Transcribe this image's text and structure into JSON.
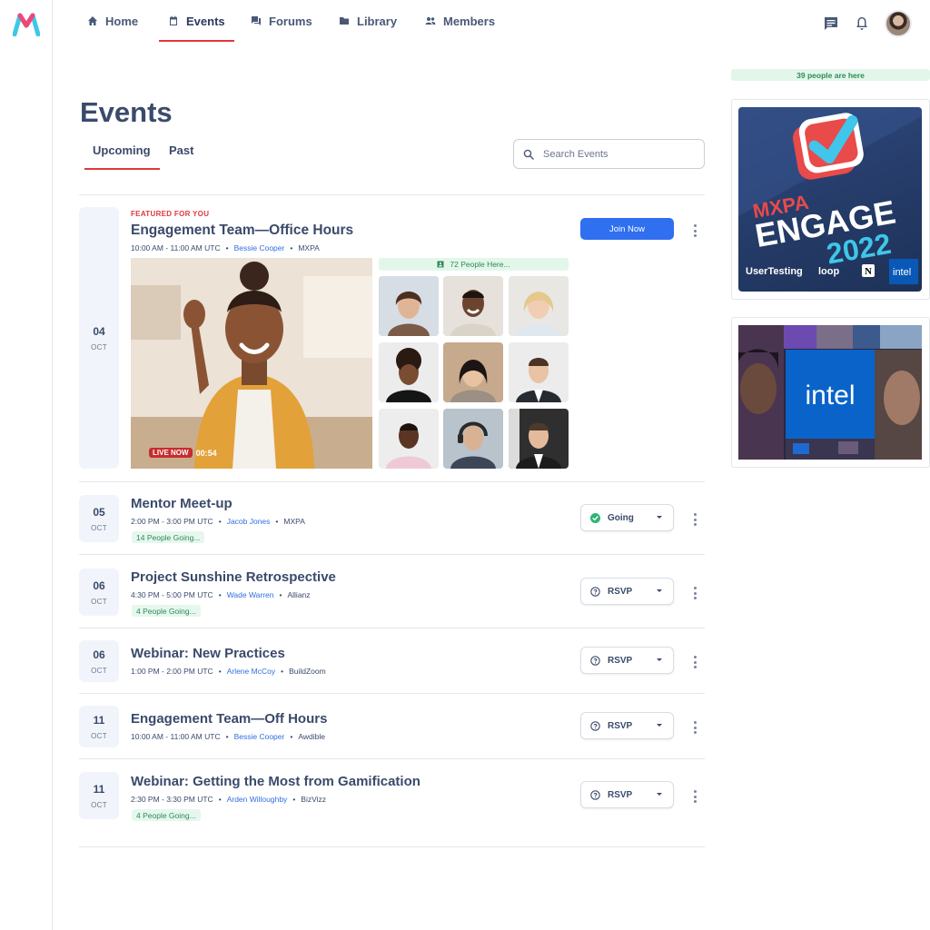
{
  "nav": {
    "items": [
      {
        "label": "Home",
        "icon": "home-icon"
      },
      {
        "label": "Events",
        "icon": "calendar-icon",
        "active": true
      },
      {
        "label": "Forums",
        "icon": "forum-icon"
      },
      {
        "label": "Library",
        "icon": "folder-icon"
      },
      {
        "label": "Members",
        "icon": "members-icon"
      }
    ],
    "right_icons": [
      "chat-icon",
      "bell-icon",
      "avatar"
    ]
  },
  "page": {
    "title": "Events",
    "tabs": [
      "Upcoming",
      "Past"
    ],
    "active_tab": "Upcoming",
    "search_placeholder": "Search Events"
  },
  "featured": {
    "label": "FEATURED FOR YOU",
    "day": "04",
    "month": "OCT",
    "title": "Engagement Team—Office Hours",
    "time": "10:00 AM - 11:00 AM UTC",
    "host": "Bessie Cooper",
    "org": "MXPA",
    "join_label": "Join Now",
    "live_label": "LIVE NOW",
    "live_time": "00:54",
    "people_here": "72 People Here..."
  },
  "events": [
    {
      "day": "05",
      "month": "OCT",
      "title": "Mentor Meet-up",
      "time": "2:00 PM - 3:00 PM UTC",
      "host": "Jacob Jones",
      "org": "MXPA",
      "going": "14 People Going...",
      "status": "Going"
    },
    {
      "day": "06",
      "month": "OCT",
      "title": "Project Sunshine Retrospective",
      "time": "4:30 PM - 5:00 PM UTC",
      "host": "Wade Warren",
      "org": "Allianz",
      "going": "4 People Going...",
      "status": "RSVP"
    },
    {
      "day": "06",
      "month": "OCT",
      "title": "Webinar: New Practices",
      "time": "1:00 PM - 2:00 PM UTC",
      "host": "Arlene McCoy",
      "org": "BuildZoom",
      "status": "RSVP"
    },
    {
      "day": "11",
      "month": "OCT",
      "title": "Engagement Team—Off Hours",
      "time": "10:00 AM - 11:00 AM UTC",
      "host": "Bessie Cooper",
      "org": "Awdible",
      "status": "RSVP"
    },
    {
      "day": "11",
      "month": "OCT",
      "title": "Webinar: Getting the Most from Gamification",
      "time": "2:30 PM - 3:30 PM UTC",
      "host": "Arden Willoughby",
      "org": "BizVizz",
      "going": "4 People Going...",
      "status": "RSVP"
    }
  ],
  "sidebar": {
    "people_here": "39 people are here",
    "ad1": {
      "line1": "MXPA",
      "line2": "ENGAGE",
      "line3": "2022",
      "sponsors": [
        "UserTesting",
        "loop",
        "N",
        "intel"
      ]
    },
    "ad2": {
      "brand": "intel"
    }
  },
  "colors": {
    "accent_red": "#e0383e",
    "primary_blue": "#2f6ff0",
    "text": "#3a4a6b",
    "success_green": "#2d8a5a"
  }
}
